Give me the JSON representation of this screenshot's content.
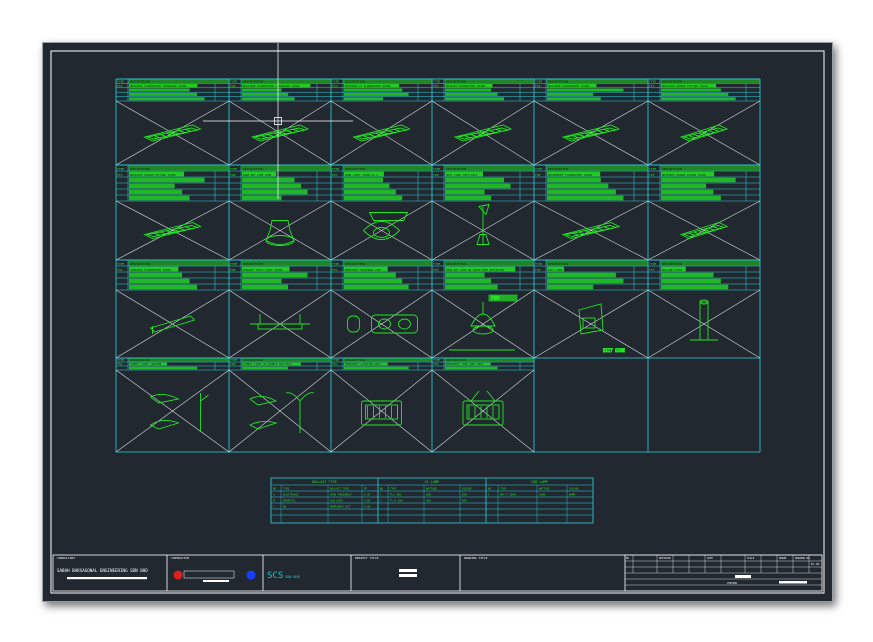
{
  "app": {
    "screen": "CAD drawing viewport"
  },
  "colors": {
    "background": "#212830",
    "frame": "#ffffff",
    "grid": "#2fd4e0",
    "fixture": "#22e622",
    "header": "#1fd21f",
    "accent_red": "#e0201a",
    "accent_blue": "#1a3cff"
  },
  "schedule": {
    "header_labels": {
      "type": "TYPE",
      "description": "DESCRIPTION"
    },
    "rows": [
      [
        "F1A",
        "F1B",
        "F1C",
        "F1D",
        "F1E",
        "F1F"
      ],
      [
        "F2A",
        "F2B",
        "F2C",
        "F2D",
        "F2E",
        "F2F"
      ],
      [
        "F3A",
        "F3B",
        "F3C",
        "F3D",
        "F3E",
        "F3F"
      ],
      [
        "F4A",
        "F4B",
        "F4C",
        "F4D",
        "",
        ""
      ]
    ],
    "row1_descriptions": [
      "RECESSED FLUORESCENT LUMINAIRE 2X36W",
      "RECESSED FLUORESCENT LUMINAIRE 1X36W",
      "RECESSED T5 FLUORESCENT 2X28W",
      "SURFACE FLUORESCENT 2X36W",
      "RECESSED FLUORESCENT 2X18W",
      "RECESSED LOUVRE FITTING 3X14W"
    ],
    "row2_descriptions": [
      "RECESSED LOUVRE FITTING 2X36W",
      "HIGH BAY LAMP 250W",
      "DOWN LIGHT 2X26W PL-C",
      "SPOT LIGHT WITH POLE",
      "WATERPROOF FLUORESCENT 1X36W",
      "RECESSED SQUARE LOUVRE 4X18W"
    ],
    "row3_descriptions": [
      "CORRIDOR FLUORESCENT 1X36W",
      "PENDANT STRIP LIGHT 2X36W",
      "EMERGENCY BULKHEAD LAMP",
      "HIGH BAY LAMP ON CHAIN WITH REFLECTOR",
      "EXIT SIGN",
      "BOLLARD LIGHT"
    ],
    "row4_descriptions": [
      "STREET LIGHT LANTERN",
      "STREET LIGHT ON DOUBLE ARM POLE",
      "EMERGENCY LIGHTING UNIT",
      "EMERGENCY TWIN SPOT UNIT"
    ],
    "fixture_note": "EXIT SIGN",
    "tag_label": "F3D"
  },
  "legend_table": {
    "sections": [
      "BALLAST TYPE",
      "FL LAMP",
      "HID LAMP"
    ],
    "col_headers": [
      "NO",
      "TYPE",
      "BALLAST TYPE",
      "PF",
      "NO",
      "TYPE",
      "WATTAGE",
      "COLOUR",
      "NO",
      "TYPE",
      "WATTAGE",
      "COLOUR"
    ],
    "rows": [
      [
        "A",
        "ELECTRONIC",
        "HIGH FREQUENCY",
        "0.95",
        "1",
        "TL5 28W",
        "28W",
        "840",
        "1",
        "HPI-T 250W",
        "250W",
        "WARM"
      ],
      [
        "B",
        "MAGNETIC",
        "LOW LOSS",
        "0.85",
        "2",
        "TL-D 36W",
        "36W",
        "840",
        "",
        "",
        "",
        ""
      ],
      [
        "C",
        "EM",
        "EMERGENCY KIT",
        "0.90",
        "",
        "",
        "",
        "",
        "",
        "",
        "",
        ""
      ],
      [
        "",
        "",
        "",
        "",
        "",
        "",
        "",
        "",
        "",
        "",
        "",
        ""
      ]
    ]
  },
  "title_block": {
    "consultant_label": "CONSULTANT",
    "company_name": "SABAH BARSAGONAL ENGINEERING SDN BHD",
    "company_sub": "ELECTRICAL & MECHANICAL ENGINEERS",
    "contractor_label": "CONTRACTOR",
    "logo_text": "SCS",
    "logo_sub": "SDN BHD",
    "project_label": "PROJECT TITLE",
    "drawing_label": "DRAWING TITLE",
    "date_label": "DATE",
    "revision_label": "REVISION",
    "scale_label": "SCALE",
    "drawn_label": "DRAWN",
    "checked_label": "CHECKED",
    "drawing_no_label": "DRAWING NO.",
    "drawing_no": "EL-05"
  }
}
